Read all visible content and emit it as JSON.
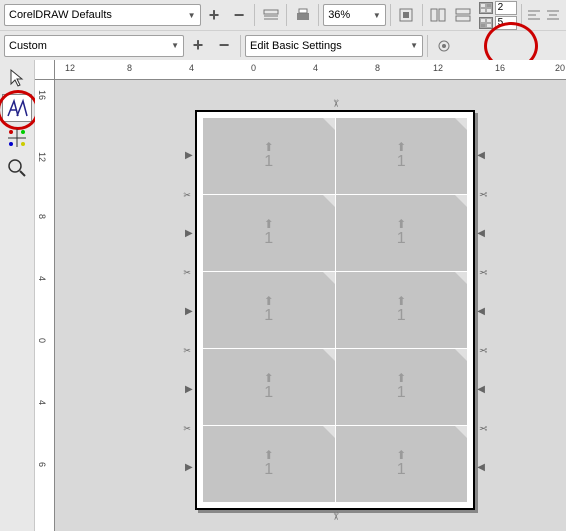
{
  "bar1": {
    "preset": "CorelDRAW Defaults",
    "zoom": "36%",
    "cols": "2",
    "rows": "5"
  },
  "bar2": {
    "label_preset": "Custom",
    "edit": "Edit Basic Settings"
  },
  "ruler_h": [
    "12",
    "8",
    "4",
    "0",
    "4",
    "8",
    "12",
    "16",
    "20"
  ],
  "ruler_v": [
    "16",
    "12",
    "8",
    "4",
    "0",
    "4",
    "6"
  ],
  "cell_label": "1",
  "arrow_up": "⬆",
  "scissors": "✂",
  "tri_left": "◀",
  "tri_right": "▶"
}
